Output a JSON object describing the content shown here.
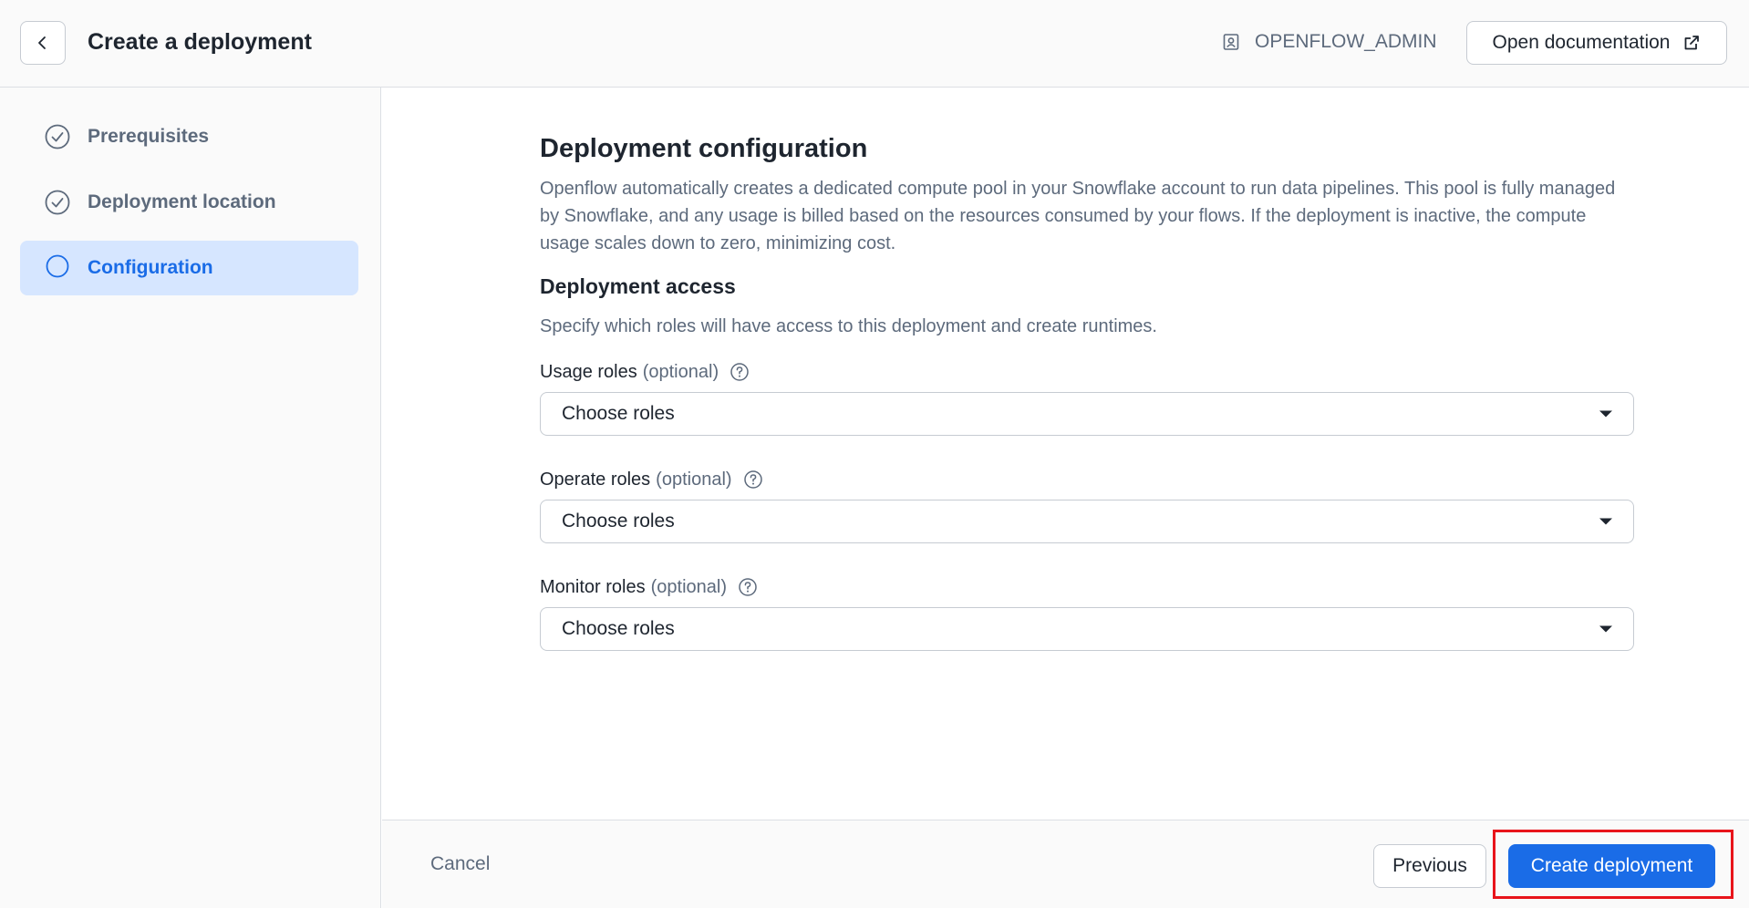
{
  "header": {
    "title": "Create a deployment",
    "role": "OPENFLOW_ADMIN",
    "doc_button": "Open documentation"
  },
  "sidebar": {
    "steps": [
      {
        "label": "Prerequisites",
        "state": "done"
      },
      {
        "label": "Deployment location",
        "state": "done"
      },
      {
        "label": "Configuration",
        "state": "active"
      }
    ]
  },
  "main": {
    "title": "Deployment configuration",
    "description": "Openflow automatically creates a dedicated compute pool in your Snowflake account to run data pipelines. This pool is fully managed by Snowflake, and any usage is billed based on the resources consumed by your flows. If the deployment is inactive, the compute usage scales down to zero, minimizing cost.",
    "access_title": "Deployment access",
    "access_description": "Specify which roles will have access to this deployment and create runtimes.",
    "fields": [
      {
        "label": "Usage roles",
        "optional": "(optional)",
        "placeholder": "Choose roles"
      },
      {
        "label": "Operate roles",
        "optional": "(optional)",
        "placeholder": "Choose roles"
      },
      {
        "label": "Monitor roles",
        "optional": "(optional)",
        "placeholder": "Choose roles"
      }
    ]
  },
  "footer": {
    "cancel": "Cancel",
    "previous": "Previous",
    "create": "Create deployment"
  },
  "colors": {
    "accent": "#1a6ce7",
    "active_step_bg": "#d6e6ff",
    "highlight": "#e8141b"
  }
}
